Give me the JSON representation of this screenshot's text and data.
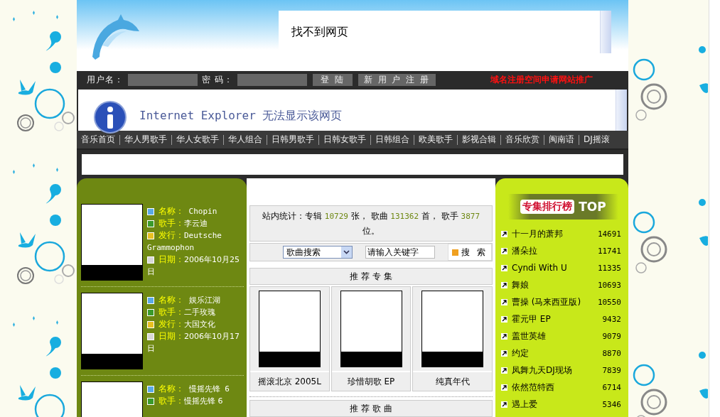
{
  "header": {
    "frame_message": "找不到网页"
  },
  "login": {
    "username_label": "用户名：",
    "password_label": "密 码：",
    "login_button": "登 陆",
    "register_button": "新 用 户 注 册",
    "promo": "域名注册空间申请网站推广"
  },
  "error_frame": {
    "message": "Internet Explorer 无法显示该网页"
  },
  "nav": [
    "音乐首页",
    "华人男歌手",
    "华人女歌手",
    "华人组合",
    "日韩男歌手",
    "日韩女歌手",
    "日韩组合",
    "欧美歌手",
    "影视合辑",
    "音乐欣赏",
    "闽南语",
    "DJ摇滚"
  ],
  "sidebar_albums": [
    {
      "fields": [
        {
          "kind": "name",
          "label": "名称：",
          "value": " Chopin"
        },
        {
          "kind": "artist",
          "label": "歌手：",
          "value": "李云迪"
        },
        {
          "kind": "publisher",
          "label": "发行：",
          "value": "Deutsche Grammophon"
        },
        {
          "kind": "date",
          "label": "日期：",
          "value": "2006年10月25日"
        }
      ]
    },
    {
      "fields": [
        {
          "kind": "name",
          "label": "名称：",
          "value": " 娱乐江湖"
        },
        {
          "kind": "artist",
          "label": "歌手：",
          "value": "二手玫瑰"
        },
        {
          "kind": "publisher",
          "label": "发行：",
          "value": "大国文化"
        },
        {
          "kind": "date",
          "label": "日期：",
          "value": "2006年10月17日"
        }
      ]
    },
    {
      "fields": [
        {
          "kind": "name",
          "label": "名称：",
          "value": " 慢摇先锋 6"
        },
        {
          "kind": "artist",
          "label": "歌手：",
          "value": "慢摇先锋 6"
        }
      ]
    }
  ],
  "stats": {
    "parts": [
      {
        "text": "站内统计：专辑 ",
        "highlight": false
      },
      {
        "text": "10729",
        "highlight": true
      },
      {
        "text": " 张， 歌曲 ",
        "highlight": false
      },
      {
        "text": "131362",
        "highlight": true
      },
      {
        "text": " 首， 歌手 ",
        "highlight": false
      },
      {
        "text": "3877",
        "highlight": true
      },
      {
        "text": " 位。",
        "highlight": false
      }
    ]
  },
  "search": {
    "category": "歌曲搜索",
    "keyword": "请输入关键字",
    "button": "搜 索"
  },
  "recommended_albums": {
    "title": "推 荐 专 集",
    "albums": [
      {
        "title": "摇滚北京 2005L"
      },
      {
        "title": "珍惜胡歌 EP"
      },
      {
        "title": "纯真年代"
      }
    ]
  },
  "recommended_songs": {
    "title": "推 荐 歌 曲"
  },
  "ranking": {
    "logo_text": "专集排行榜",
    "logo_badge": "TOP",
    "items": [
      {
        "name": "十一月的萧邦",
        "count": "14691"
      },
      {
        "name": "潘朵拉",
        "count": "11741"
      },
      {
        "name": "Cyndi With U",
        "count": "11335"
      },
      {
        "name": "舞娘",
        "count": "10693"
      },
      {
        "name": "曹操 (马来西亚版)",
        "count": "10550"
      },
      {
        "name": "霍元甲 EP",
        "count": "9432"
      },
      {
        "name": "盖世英雄",
        "count": "9079"
      },
      {
        "name": "约定",
        "count": "8870"
      },
      {
        "name": "凤舞九天DJ现场",
        "count": "7839"
      },
      {
        "name": "依然范特西",
        "count": "6714"
      },
      {
        "name": "遇上爱",
        "count": "5346"
      }
    ]
  }
}
